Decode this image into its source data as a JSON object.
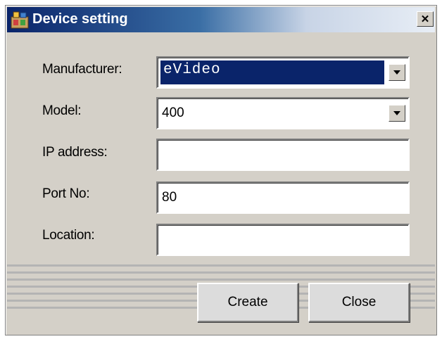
{
  "window": {
    "title": "Device setting",
    "close_symbol": "✕",
    "icon": "app-icon"
  },
  "form": {
    "manufacturer_label": "Manufacturer:",
    "manufacturer_value": "eVideo",
    "model_label": "Model:",
    "model_value": "400",
    "ip_label": "IP address:",
    "ip_value": "",
    "port_label": "Port No:",
    "port_value": "80",
    "location_label": "Location:",
    "location_value": ""
  },
  "buttons": {
    "create_label": "Create",
    "close_label": "Close"
  },
  "colors": {
    "title_bar": "#0a246a",
    "dialog_face": "#d4d0c8",
    "selection": "#0a246a"
  }
}
